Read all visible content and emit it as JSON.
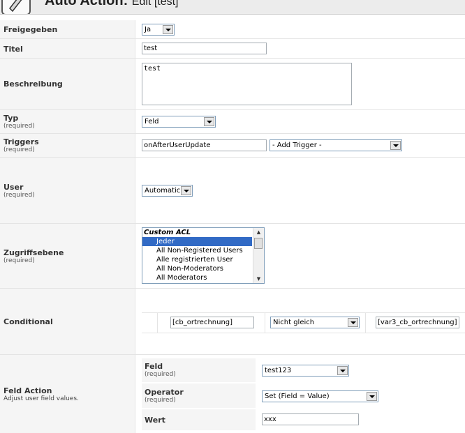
{
  "header": {
    "title": "Auto Action:",
    "subtitle": "Edit [test]"
  },
  "form": {
    "freigegeben": {
      "label": "Freigegeben",
      "value": "Ja"
    },
    "titel": {
      "label": "Titel",
      "value": "test"
    },
    "beschreibung": {
      "label": "Beschreibung",
      "value": "test"
    },
    "typ": {
      "label": "Typ",
      "required": "(required)",
      "value": "Feld"
    },
    "triggers": {
      "label": "Triggers",
      "required": "(required)",
      "value": "onAfterUserUpdate",
      "add_trigger": "- Add Trigger -"
    },
    "user": {
      "label": "User",
      "required": "(required)",
      "value": "Automatic"
    },
    "zugriffsebene": {
      "label": "Zugriffsebene",
      "required": "(required)",
      "options": [
        {
          "text": "Custom ACL",
          "group": true,
          "selected": false
        },
        {
          "text": "Jeder",
          "group": false,
          "selected": true
        },
        {
          "text": "All Non-Registered Users",
          "group": false,
          "selected": false
        },
        {
          "text": "Alle registrierten User",
          "group": false,
          "selected": false
        },
        {
          "text": "All Non-Moderators",
          "group": false,
          "selected": false
        },
        {
          "text": "All Moderators",
          "group": false,
          "selected": false
        }
      ]
    },
    "conditional": {
      "label": "Conditional",
      "field": "[cb_ortrechnung]",
      "operator": "Nicht gleich",
      "value": "[var3_cb_ortrechnung]"
    },
    "feld_action": {
      "label": "Feld Action",
      "description": "Adjust user field values.",
      "feld": {
        "label": "Feld",
        "required": "(required)",
        "value": "test123"
      },
      "operator": {
        "label": "Operator",
        "required": "(required)",
        "value": "Set (Field = Value)"
      },
      "wert": {
        "label": "Wert",
        "value": "xxx"
      }
    }
  }
}
